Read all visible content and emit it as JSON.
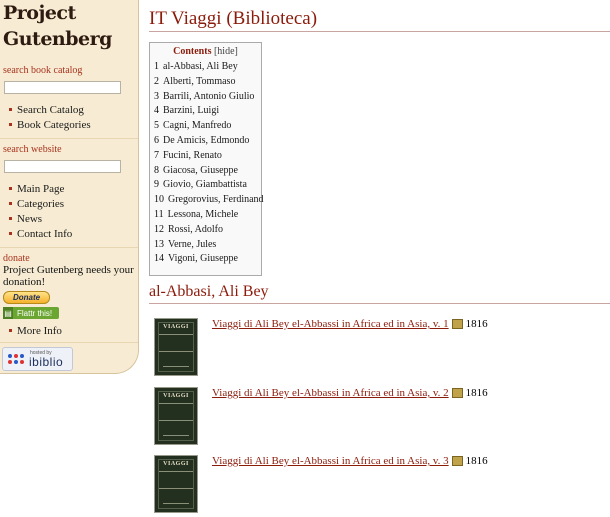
{
  "sidebar": {
    "logo": {
      "line1": "Project",
      "line2": "Gutenberg"
    },
    "search_catalog_heading": "search book catalog",
    "catalog_links": [
      "Search Catalog",
      "Book Categories"
    ],
    "search_website_heading": "search website",
    "site_links": [
      "Main Page",
      "Categories",
      "News",
      "Contact Info"
    ],
    "donate_heading": "donate",
    "donate_text": "Project Gutenberg needs your donation!",
    "donate_button": "Donate",
    "flattr_button": "Flattr this!",
    "more_links": [
      "More Info"
    ],
    "hosted_by": "hosted by",
    "ibiblio": "ibiblio"
  },
  "page": {
    "title": "IT Viaggi (Biblioteca)",
    "toc_title": "Contents",
    "toc_hide": "[hide]",
    "toc": [
      {
        "n": "1",
        "t": "al-Abbasi, Ali Bey"
      },
      {
        "n": "2",
        "t": "Alberti, Tommaso"
      },
      {
        "n": "3",
        "t": "Barrili, Antonio Giulio"
      },
      {
        "n": "4",
        "t": "Barzini, Luigi"
      },
      {
        "n": "5",
        "t": "Cagni, Manfredo"
      },
      {
        "n": "6",
        "t": "De Amicis, Edmondo"
      },
      {
        "n": "7",
        "t": "Fucini, Renato"
      },
      {
        "n": "8",
        "t": "Giacosa, Giuseppe"
      },
      {
        "n": "9",
        "t": "Giovio, Giambattista"
      },
      {
        "n": "10",
        "t": "Gregorovius, Ferdinand"
      },
      {
        "n": "11",
        "t": "Lessona, Michele"
      },
      {
        "n": "12",
        "t": "Rossi, Adolfo"
      },
      {
        "n": "13",
        "t": "Verne, Jules"
      },
      {
        "n": "14",
        "t": "Vigoni, Giuseppe"
      }
    ],
    "section_title": "al-Abbasi, Ali Bey",
    "books": [
      {
        "title": "Viaggi di Ali Bey el-Abbassi in Africa ed in Asia, v. 1",
        "year": "1816",
        "cover_text": "VIAGGI"
      },
      {
        "title": "Viaggi di Ali Bey el-Abbassi in Africa ed in Asia, v. 2",
        "year": "1816",
        "cover_text": "VIAGGI"
      },
      {
        "title": "Viaggi di Ali Bey el-Abbassi in Africa ed in Asia, v. 3",
        "year": "1816",
        "cover_text": "VIAGGI"
      }
    ]
  }
}
